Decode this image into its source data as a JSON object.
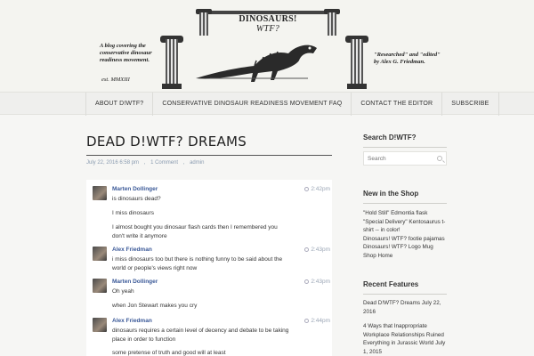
{
  "header": {
    "banner_title": "DINOSAURS!",
    "banner_subtitle": "WTF?",
    "tagline": "A blog covering the conservative dinosaur readiness movement.",
    "est": "est. MMXIII",
    "credit": "\"Researched\" and \"edited\" by Alex G. Friedman."
  },
  "nav": {
    "items": [
      "ABOUT D!WTF?",
      "CONSERVATIVE DINOSAUR READINESS MOVEMENT FAQ",
      "CONTACT THE EDITOR",
      "SUBSCRIBE"
    ]
  },
  "post": {
    "title": "DEAD D!WTF? DREAMS",
    "date": "July 22, 2016 6:58 pm",
    "comments": "1 Comment",
    "author": "admin",
    "sep": ","
  },
  "chat": [
    {
      "sender": "Marten Dollinger",
      "time": "2:42pm",
      "lines": [
        "is dinosaurs dead?",
        "I miss dinosaurs",
        "I almost bought you dinosaur flash cards then I remembered you",
        "don't write it anymore"
      ]
    },
    {
      "sender": "Alex Friedman",
      "time": "2:43pm",
      "lines": [
        "i miss dinosaurs too but there is nothing funny to be said about the",
        "world or people's views right now"
      ]
    },
    {
      "sender": "Marten Dollinger",
      "time": "2:43pm",
      "lines": [
        "Oh yeah",
        "when Jon Stewart makes you cry"
      ]
    },
    {
      "sender": "Alex Friedman",
      "time": "2:44pm",
      "lines": [
        "dinosaurs requires a certain level of decency and debate to be taking",
        "place in order to function",
        "some pretense of truth and good will at least"
      ]
    }
  ],
  "sidebar": {
    "search_heading": "Search D!WTF?",
    "search_placeholder": "Search",
    "shop_heading": "New in the Shop",
    "shop_lines": [
      "\"Hold Still\" Edmontia flask",
      "\"Special Delivery\" Kentosaurus t-",
      "shirt -- in color!",
      "Dinosaurs! WTF? footie pajamas",
      "Dinosaurs! WTF? Logo Mug",
      "Shop Home"
    ],
    "recent_heading": "Recent Features",
    "recent": [
      "Dead D!WTF? Dreams July 22, 2016",
      "4 Ways that Inappropriate Workplace Relationships Ruined Everything in Jurassic World July 1, 2015"
    ]
  },
  "colors": {
    "link": "#3b5998",
    "meta": "#8a9bb0"
  }
}
